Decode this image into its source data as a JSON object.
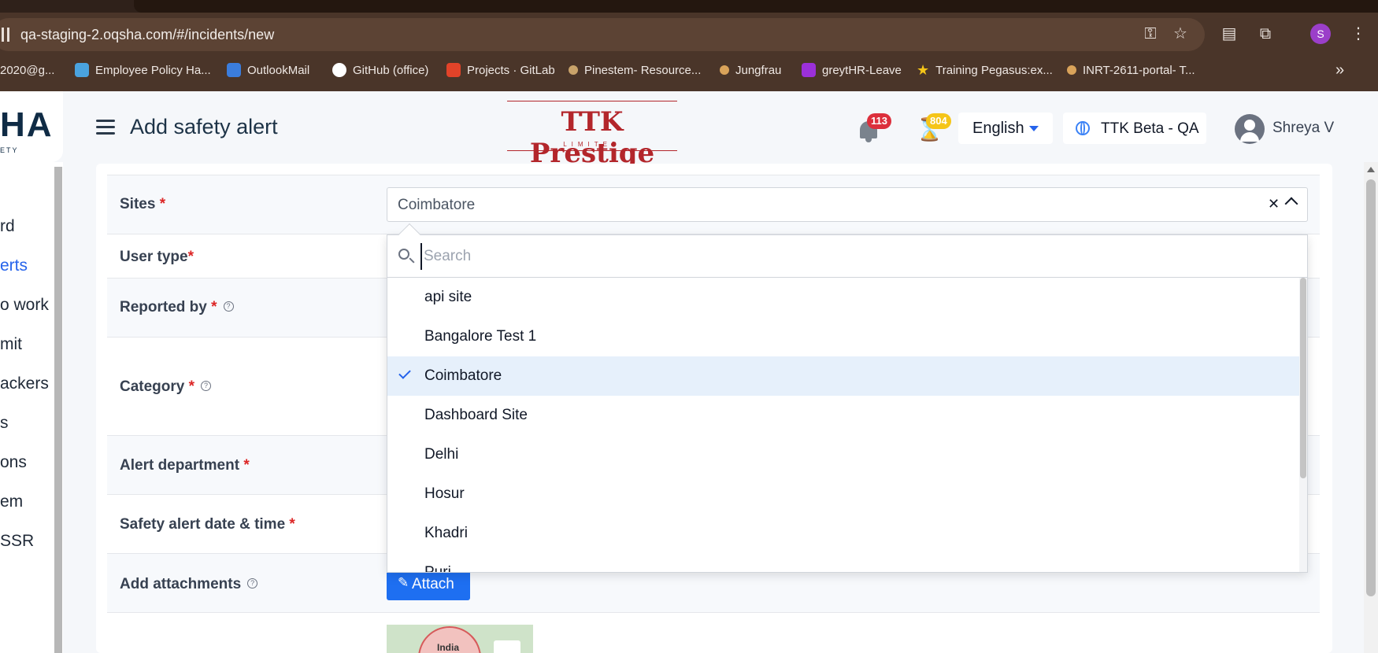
{
  "browser": {
    "url": "qa-staging-2.oqsha.com/#/incidents/new",
    "bookmarks": [
      {
        "label": "2020@g...",
        "color": "#5b8def"
      },
      {
        "label": "Employee Policy Ha...",
        "color": "#4aa3df"
      },
      {
        "label": "OutlookMail",
        "color": "#3b7ddd"
      },
      {
        "label": "GitHub (office)",
        "color": "#ffffff"
      },
      {
        "label": "Projects · GitLab",
        "color": "#e24329"
      },
      {
        "label": "Pinestem- Resource...",
        "color": "#c9a36a"
      },
      {
        "label": "Jungfrau",
        "color": "#d9a35a"
      },
      {
        "label": "greytHR-Leave",
        "color": "#9b30d9"
      },
      {
        "label": "Training Pegasus:ex...",
        "color": "#f5c518"
      },
      {
        "label": "INRT-2611-portal- T...",
        "color": "#d9a35a"
      }
    ],
    "more_bookmarks": "»",
    "profile_initial": "S"
  },
  "app": {
    "logo_text": "HA",
    "logo_tagline": "ETY",
    "page_title": "Add safety alert",
    "brand_name": "TTK Prestige",
    "brand_sub": "LIMITED",
    "notifications_count": "113",
    "pending_count": "804",
    "language": "English",
    "tenant": "TTK Beta - QA",
    "user_name": "Shreya V"
  },
  "sidebar": {
    "items": [
      "rd",
      "erts",
      "o work",
      "mit",
      "ackers",
      "s",
      "ons",
      "em",
      "SSR"
    ]
  },
  "form": {
    "sites_label": "Sites",
    "user_type_label": "User type",
    "reported_by_label": "Reported by",
    "category_label": "Category",
    "alert_department_label": "Alert department",
    "date_time_label": "Safety alert date & time",
    "attachments_label": "Add attachments",
    "required_mark": "*",
    "sites_value": "Coimbatore",
    "attach_button": "Attach",
    "map_label": "India"
  },
  "dropdown": {
    "search_placeholder": "Search",
    "options": [
      "api site",
      "Bangalore Test 1",
      "Coimbatore",
      "Dashboard Site",
      "Delhi",
      "Hosur",
      "Khadri",
      "Puri"
    ],
    "selected": "Coimbatore"
  }
}
